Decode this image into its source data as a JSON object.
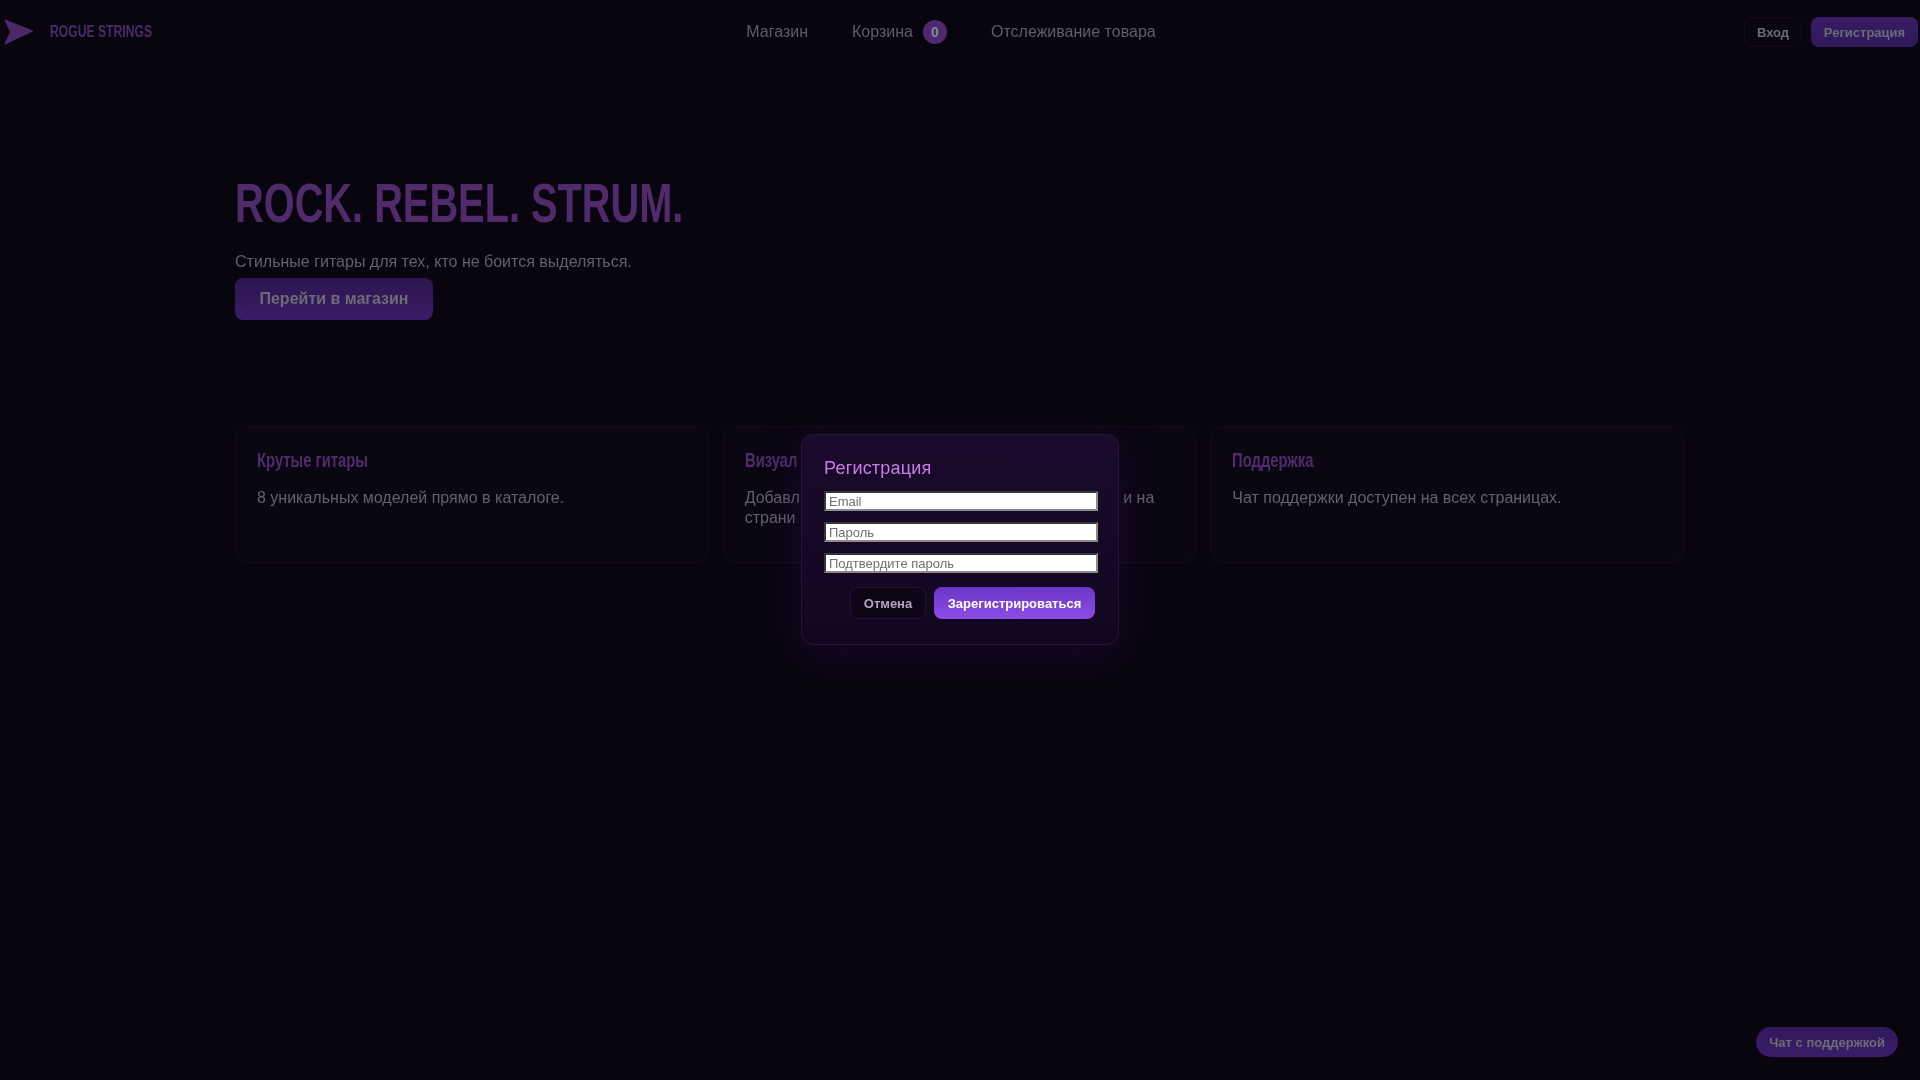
{
  "header": {
    "logo": "ROGUE STRINGS",
    "nav": [
      {
        "label": "Магазин"
      },
      {
        "label": "Корзина",
        "badge": "0"
      },
      {
        "label": "Отслеживание товара"
      }
    ],
    "auth_buttons": [
      {
        "label": "Вход",
        "kind": "ghost"
      },
      {
        "label": "Регистрация",
        "kind": "primary"
      }
    ]
  },
  "hero": {
    "title": "ROCK. REBEL. STRUM.",
    "subtitle": "Стильные гитары для тех, кто не боится выделяться.",
    "button": "Перейти в магазин"
  },
  "features": [
    {
      "kind": "text",
      "title": "Крутые гитары",
      "text": "8 уникальных моделей прямо в каталоге."
    },
    {
      "kind": "covered",
      "title": "Визуал",
      "lines": [
        {
          "start": "Добавл",
          "end": "и на"
        },
        {
          "start": "страни"
        }
      ]
    },
    {
      "kind": "text",
      "title": "Поддержка",
      "text": "Чат поддержки доступен на всех страницах."
    }
  ],
  "modal": {
    "title": "Регистрация",
    "fields": [
      {
        "placeholder": "Email"
      },
      {
        "placeholder": "Пароль"
      },
      {
        "placeholder": "Подтвердите пароль"
      }
    ],
    "buttons": [
      {
        "label": "Отмена",
        "kind": "secondary"
      },
      {
        "label": "Зарегистрироваться",
        "kind": "primary"
      }
    ]
  },
  "chat_button": "Чат с поддержкой"
}
